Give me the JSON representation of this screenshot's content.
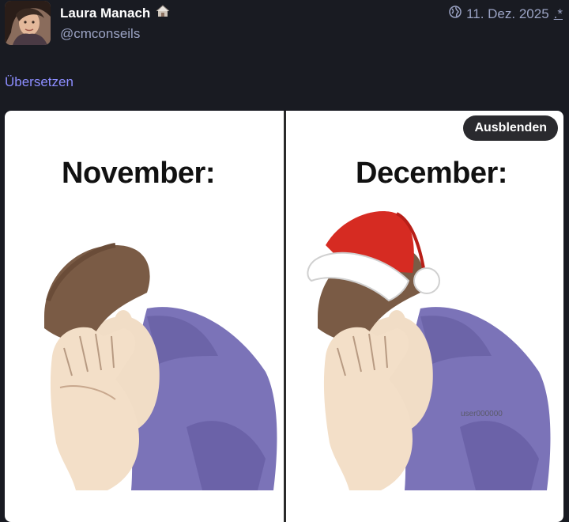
{
  "post": {
    "display_name": "Laura Manach",
    "handle": "@cmconseils",
    "date": "11. Dez. 2025",
    "edited_marker": ".*",
    "translate_label": "Übersetzen"
  },
  "media": {
    "hide_label": "Ausblenden",
    "left_title": "November:",
    "right_title": "December:",
    "watermark": "user000000"
  },
  "icons": {
    "name_emoji": "house-emoji-icon",
    "visibility": "globe-icon"
  },
  "colors": {
    "background": "#191b22",
    "accent_link": "#8c8dff",
    "muted_text": "#9ba3c4",
    "shirt": "#7b73b8"
  }
}
